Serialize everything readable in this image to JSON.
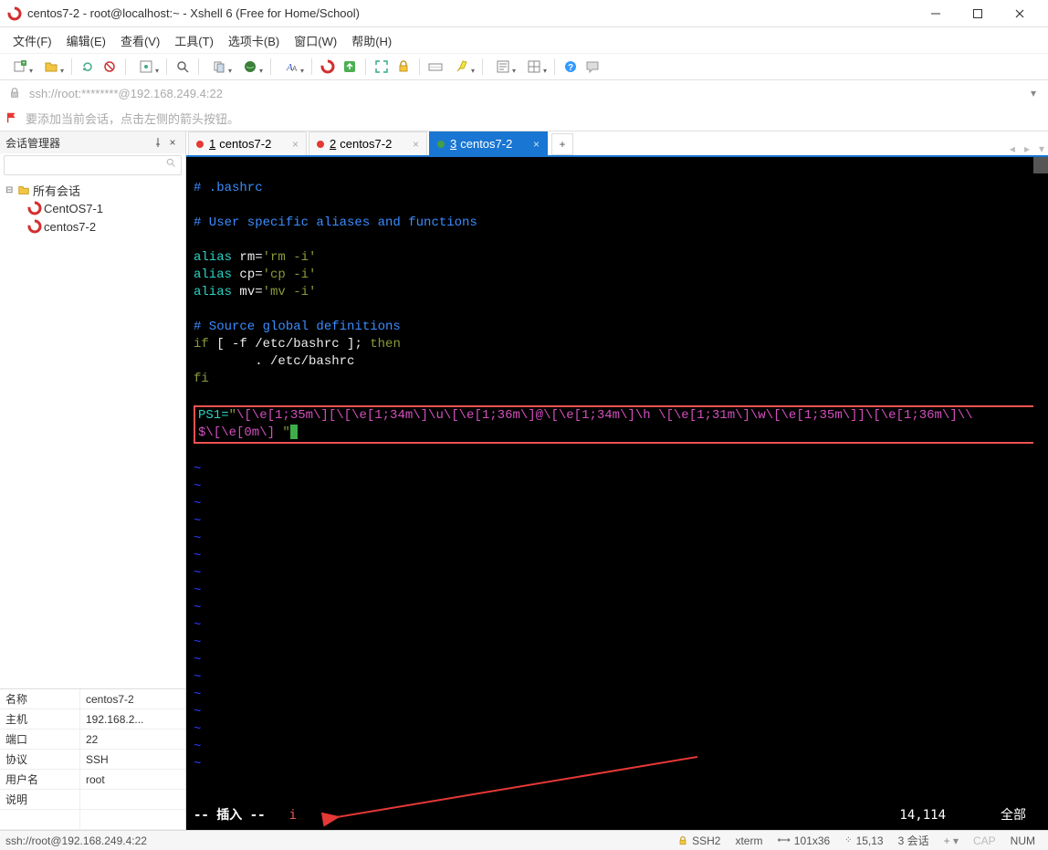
{
  "window": {
    "title": "centos7-2 - root@localhost:~ - Xshell 6 (Free for Home/School)"
  },
  "menu": {
    "file": "文件(F)",
    "edit": "编辑(E)",
    "view": "查看(V)",
    "tools": "工具(T)",
    "tabs": "选项卡(B)",
    "window": "窗口(W)",
    "help": "帮助(H)"
  },
  "addressbar": {
    "url": "ssh://root:********@192.168.249.4:22"
  },
  "hint": {
    "text": "要添加当前会话，点击左侧的箭头按钮。"
  },
  "sidebar": {
    "title": "会话管理器",
    "root": "所有会话",
    "items": [
      {
        "label": "CentOS7-1"
      },
      {
        "label": "centos7-2"
      }
    ]
  },
  "properties": {
    "name_k": "名称",
    "name_v": "centos7-2",
    "host_k": "主机",
    "host_v": "192.168.2...",
    "port_k": "端口",
    "port_v": "22",
    "proto_k": "协议",
    "proto_v": "SSH",
    "user_k": "用户名",
    "user_v": "root",
    "desc_k": "说明",
    "desc_v": ""
  },
  "tabs": [
    {
      "num": "1",
      "label": "centos7-2",
      "color": "red",
      "active": false
    },
    {
      "num": "2",
      "label": "centos7-2",
      "color": "red",
      "active": false
    },
    {
      "num": "3",
      "label": "centos7-2",
      "color": "green",
      "active": true
    }
  ],
  "terminal": {
    "l1": "# .bashrc",
    "l2": "# User specific aliases and functions",
    "alias_kw": "alias",
    "a1_l": " rm=",
    "a1_r": "'rm -i'",
    "a2_l": " cp=",
    "a2_r": "'cp -i'",
    "a3_l": " mv=",
    "a3_r": "'mv -i'",
    "l3": "# Source global definitions",
    "if_kw": "if",
    "if_cond": " [ -f /etc/bashrc ]; ",
    "then_kw": "then",
    "src_line": "        . /etc/bashrc",
    "fi_kw": "fi",
    "ps1a": "PS1=",
    "ps1b": "\"",
    "ps1c": "\\[\\e[1;35m\\][\\[\\e[1;34m\\]\\u\\[\\e[1;36m\\]@\\[\\e[1;34m\\]\\h \\[\\e[1;31m\\]\\w\\[\\e[1;35m\\]]\\[\\e[1;36m\\]\\\\",
    "ps1d": "$\\[\\e[0m\\] ",
    "ps1e": "\""
  },
  "vim": {
    "mode": "-- 插入 --",
    "annotation": "i",
    "pos": "14,114",
    "scope": "全部"
  },
  "statusbar": {
    "path": "ssh://root@192.168.249.4:22",
    "ssh": "SSH2",
    "term": "xterm",
    "size": "101x36",
    "cursor": "15,13",
    "sessions": "3 会话",
    "cap": "CAP",
    "num": "NUM"
  }
}
